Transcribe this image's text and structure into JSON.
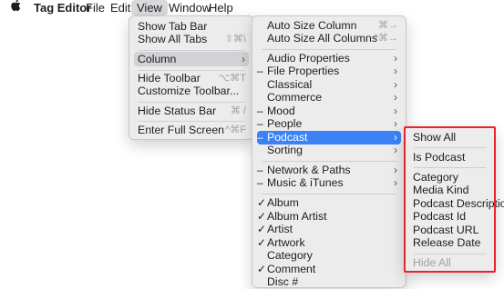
{
  "menubar": {
    "apple_icon": "apple-logo-icon",
    "app_name": "Tag Editor",
    "file": "File",
    "edit": "Edit",
    "view": "View",
    "window": "Window",
    "help": "Help"
  },
  "view_menu": {
    "show_tab_bar": "Show Tab Bar",
    "show_all_tabs": "Show All Tabs",
    "show_all_tabs_sc": "⇧⌘\\",
    "column": "Column",
    "hide_toolbar": "Hide Toolbar",
    "hide_toolbar_sc": "⌥⌘T",
    "customize_toolbar": "Customize Toolbar...",
    "hide_status_bar": "Hide Status Bar",
    "hide_status_bar_sc": "⌘ /",
    "enter_full_screen": "Enter Full Screen",
    "enter_full_screen_sc": "^⌘F"
  },
  "column_menu": {
    "auto_size_column": "Auto Size Column",
    "auto_size_column_sc": "⌘→",
    "auto_size_all": "Auto Size All Columns",
    "auto_size_all_sc": "^⌘→",
    "audio_properties": "Audio Properties",
    "file_properties": "File Properties",
    "classical": "Classical",
    "commerce": "Commerce",
    "mood": "Mood",
    "people": "People",
    "podcast": "Podcast",
    "sorting": "Sorting",
    "network_paths": "Network & Paths",
    "music_itunes": "Music & iTunes",
    "album": "Album",
    "album_artist": "Album Artist",
    "artist": "Artist",
    "artwork": "Artwork",
    "category": "Category",
    "comment": "Comment",
    "disc_partial": "Disc #",
    "mixed_mark": "–",
    "check_mark": "✓"
  },
  "podcast_menu": {
    "show_all": "Show All",
    "is_podcast": "Is Podcast",
    "category": "Category",
    "media_kind": "Media Kind",
    "podcast_description": "Podcast Description",
    "podcast_id": "Podcast Id",
    "podcast_url": "Podcast URL",
    "release_date": "Release Date",
    "hide_all": "Hide All"
  },
  "colors": {
    "selection": "#3b82f6",
    "highlight_box": "#e3262d"
  }
}
